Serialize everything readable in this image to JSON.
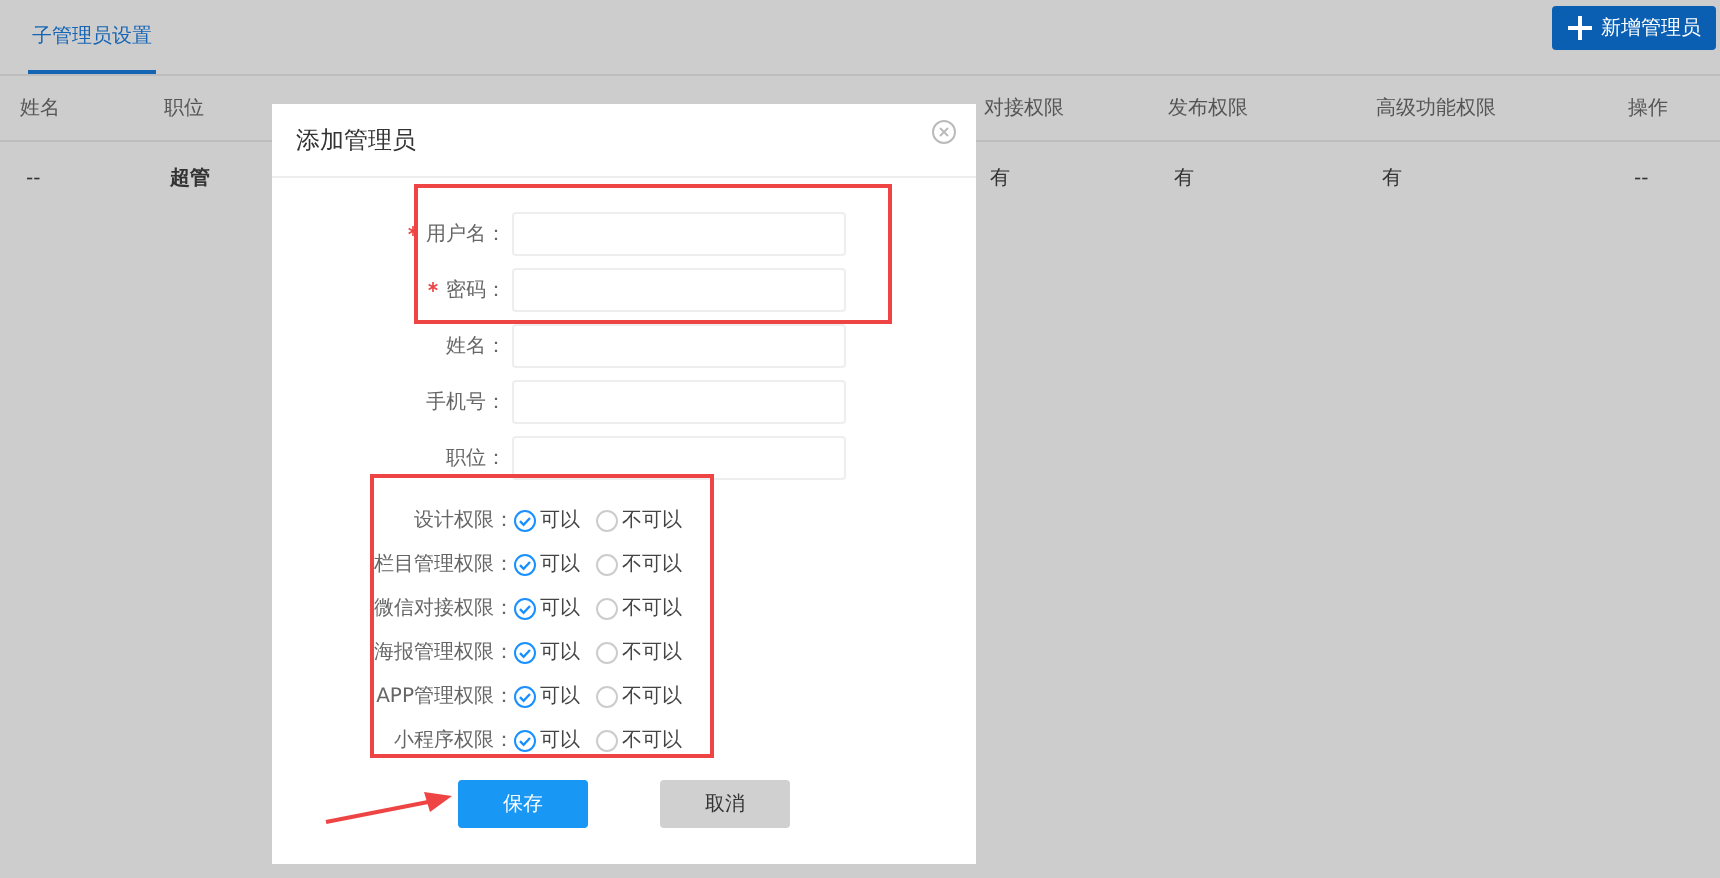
{
  "tabs": [
    {
      "label": "子管理员设置",
      "selected": true
    }
  ],
  "add_button": {
    "label": "新增管理员"
  },
  "table": {
    "columns": [
      "姓名",
      "职位",
      "对接权限",
      "发布权限",
      "高级功能权限",
      "操作"
    ],
    "rows": [
      {
        "cells": [
          "--",
          "超管",
          "有",
          "有",
          "有",
          "--"
        ]
      }
    ]
  },
  "dialog": {
    "title": "添加管理员",
    "fields": [
      {
        "label": "用户名：",
        "required": true
      },
      {
        "label": "密码：",
        "required": true
      },
      {
        "label": "姓名：",
        "required": false
      },
      {
        "label": "手机号：",
        "required": false
      },
      {
        "label": "职位：",
        "required": false
      }
    ],
    "permissions": [
      {
        "label": "设计权限：",
        "options": [
          {
            "label": "可以",
            "selected": true
          },
          {
            "label": "不可以",
            "selected": false
          }
        ]
      },
      {
        "label": "栏目管理权限：",
        "options": [
          {
            "label": "可以",
            "selected": true
          },
          {
            "label": "不可以",
            "selected": false
          }
        ]
      },
      {
        "label": "微信对接权限：",
        "options": [
          {
            "label": "可以",
            "selected": true
          },
          {
            "label": "不可以",
            "selected": false
          }
        ]
      },
      {
        "label": "海报管理权限：",
        "options": [
          {
            "label": "可以",
            "selected": true
          },
          {
            "label": "不可以",
            "selected": false
          }
        ]
      },
      {
        "label": "APP管理权限：",
        "options": [
          {
            "label": "可以",
            "selected": true
          },
          {
            "label": "不可以",
            "selected": false
          }
        ]
      },
      {
        "label": "小程序权限：",
        "options": [
          {
            "label": "可以",
            "selected": true
          },
          {
            "label": "不可以",
            "selected": false
          }
        ]
      }
    ],
    "buttons": [
      {
        "label": "保存",
        "kind": "primary"
      },
      {
        "label": "取消",
        "kind": "secondary"
      }
    ]
  }
}
